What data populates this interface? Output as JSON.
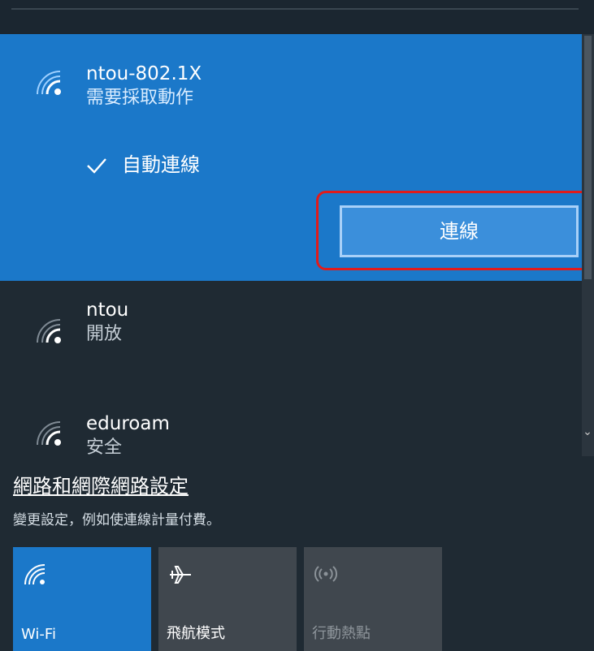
{
  "networks": [
    {
      "ssid": "ntou-802.1X",
      "status": "需要採取動作",
      "auto_connect": true
    },
    {
      "ssid": "ntou",
      "status": "開放"
    },
    {
      "ssid": "eduroam",
      "status": "安全"
    }
  ],
  "auto_connect_label": "自動連線",
  "connect_label": "連線",
  "settings": {
    "link": "網路和網際網路設定",
    "desc": "變更設定，例如使連線計量付費。"
  },
  "tiles": [
    {
      "label": "Wi-Fi",
      "icon": "wifi-icon",
      "state": "on"
    },
    {
      "label": "飛航模式",
      "icon": "airplane-icon",
      "state": "off"
    },
    {
      "label": "行動熱點",
      "icon": "hotspot-icon",
      "state": "disabled"
    }
  ],
  "colors": {
    "accent": "#1b78c9",
    "highlight_border": "#e11b1b"
  }
}
